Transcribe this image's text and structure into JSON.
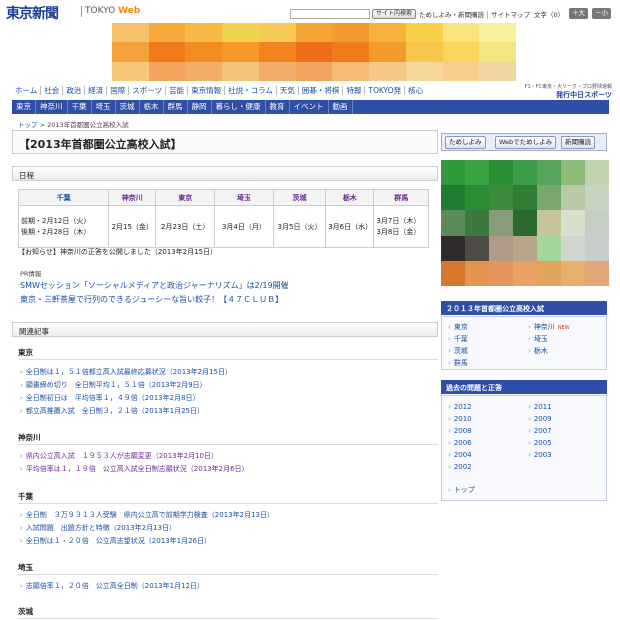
{
  "header": {
    "logo": "東京新聞",
    "logo_sub_a": "TOKYO ",
    "logo_sub_b": "Web",
    "search_placeholder": "",
    "search_button": "サイト内検索",
    "links": [
      "ためしよみ・新聞購読",
      "サイトマップ"
    ],
    "font_label": "文字（0）",
    "font_plus": "＋大",
    "font_minus": "－小"
  },
  "banner_colors": [
    "#f5c26b",
    "#f7a93c",
    "#f6b948",
    "#f2d34f",
    "#f7ca55",
    "#f4a432",
    "#f49b2f",
    "#f6b23a",
    "#f9d04a",
    "#f9e37a",
    "#f6ef9c",
    "#f3a23c",
    "#f17a1a",
    "#f48c22",
    "#f59928",
    "#f28420",
    "#ef6d16",
    "#f07a1c",
    "#f29a2a",
    "#f7c54a",
    "#f8d55c",
    "#f3e680",
    "#f6c877",
    "#f4a45c",
    "#f3ae66",
    "#f5c27c",
    "#f3ad6a",
    "#f2a35e",
    "#f5bb76",
    "#f6c98a",
    "#f8d79c",
    "#f6cd8c",
    "#f2d6a2"
  ],
  "global_nav": [
    "ホーム",
    "社会",
    "政治",
    "経済",
    "国際",
    "スポーツ",
    "芸能",
    "東京情報",
    "社説・コラム",
    "天気",
    "囲碁・将棋",
    "特報",
    "TOKYO発",
    "核心"
  ],
  "chunichi": {
    "line1": "F1・FC東京・大リーグ・プロ野球速報",
    "line2": "発行中日スポーツ"
  },
  "region_nav": [
    "東京",
    "神奈川",
    "千葉",
    "埼玉",
    "茨城",
    "栃木",
    "群馬",
    "静岡",
    "暮らし・健康",
    "教育",
    "イベント",
    "動画"
  ],
  "breadcrumb": {
    "home": "トップ",
    "sep": " > ",
    "current": "2013年首都圏公立高校入試"
  },
  "page_title": "【2013年首都圏公立高校入試】",
  "schedule": {
    "heading": "日程",
    "headers": [
      "千葉",
      "神奈川",
      "東京",
      "埼玉",
      "茨城",
      "栃木",
      "群馬"
    ],
    "chiba": [
      "前期・2月12日（火）",
      "後期・2月28日（木）"
    ],
    "cells": [
      "2月15（金）",
      "2月23日（土）",
      "3月4日（月）",
      "3月5日（火）",
      "3月6日（水）"
    ],
    "gunma": [
      "3月7日（木）",
      "3月8日（金）"
    ]
  },
  "notice": "【お知らせ】神奈川の正答を公開しました（2013年2月15日）",
  "pr": {
    "label": "PR情報",
    "links": [
      "SMWセッション「ソーシャルメディアと政治ジャーナリズム」は2/19開催",
      "東京・三軒茶屋で行列のできるジューシーな旨い餃子！【４７ＣＬＵＢ】"
    ]
  },
  "related": {
    "heading": "関連記事",
    "tokyo": {
      "name": "東京",
      "items": [
        "全日制は１，５１倍都立高入試最終応募状況（2013年2月15日）",
        "願書締め切り　全日制平均１，５１倍（2013年2月9日）",
        "全日制初日は　平均倍率１，４９倍（2013年2月8日）",
        "都立高推薦入試　全日制３，２１倍（2013年1月25日）"
      ]
    },
    "kanagawa": {
      "name": "神奈川",
      "items": [
        "県内公立高入試　１９５３人が志願変更（2013年2月10日）",
        "平均倍率は１，１９倍　公立高入試全日制志願状況（2013年2月6日）"
      ]
    },
    "chiba": {
      "name": "千葉",
      "items": [
        "全日制　３万９３１３人受験　県内公立高で前期学力検査（2013年2月13日）",
        "入試問題　出題方針と特徴（2013年2月13日）",
        "全日制は１・２０倍　公立高志望状況（2013年1月26日）"
      ]
    },
    "saitama": {
      "name": "埼玉",
      "items": [
        "志願倍率１，２０倍　公立高全日制（2013年1月12日）"
      ]
    },
    "ibaraki": {
      "name": "茨城"
    }
  },
  "right": {
    "tabs": [
      "ためしよみ",
      "Webでためしよみ",
      "新聞購読"
    ],
    "mosaic_colors": [
      "#2f9b3c",
      "#3aa342",
      "#2a8f35",
      "#3d9d47",
      "#55a45a",
      "#8cbb78",
      "#c1d4b0",
      "#1f7d2f",
      "#2b8c36",
      "#3d8b3c",
      "#2f7e33",
      "#7aa86b",
      "#b7c9a6",
      "#c9d3c2",
      "#5d8a5b",
      "#3b7a3c",
      "#8a9b7a",
      "#2a6a2e",
      "#c8c49c",
      "#d7dfcd",
      "#c6cfc4",
      "#2f2b2b",
      "#4f4b45",
      "#b19a8a",
      "#b8a58a",
      "#a3d79a",
      "#d0d6cf",
      "#c9cecb",
      "#d9772f",
      "#e3944e",
      "#e39660",
      "#e9a165",
      "#e2a35b",
      "#e8ae6c",
      "#e4a77a"
    ],
    "exam_box": {
      "title": "２０１３年首都圏公立高校入試",
      "col1": [
        "東京",
        "千葉",
        "茨城",
        "群馬"
      ],
      "col2": [
        "神奈川",
        "埼玉",
        "栃木"
      ],
      "new": "NEW"
    },
    "past_box": {
      "title": "過去の問題と正答",
      "col1": [
        "2012",
        "2010",
        "2008",
        "2006",
        "2004",
        "2002"
      ],
      "col2": [
        "2011",
        "2009",
        "2007",
        "2005",
        "2003"
      ],
      "top": "トップ"
    }
  }
}
